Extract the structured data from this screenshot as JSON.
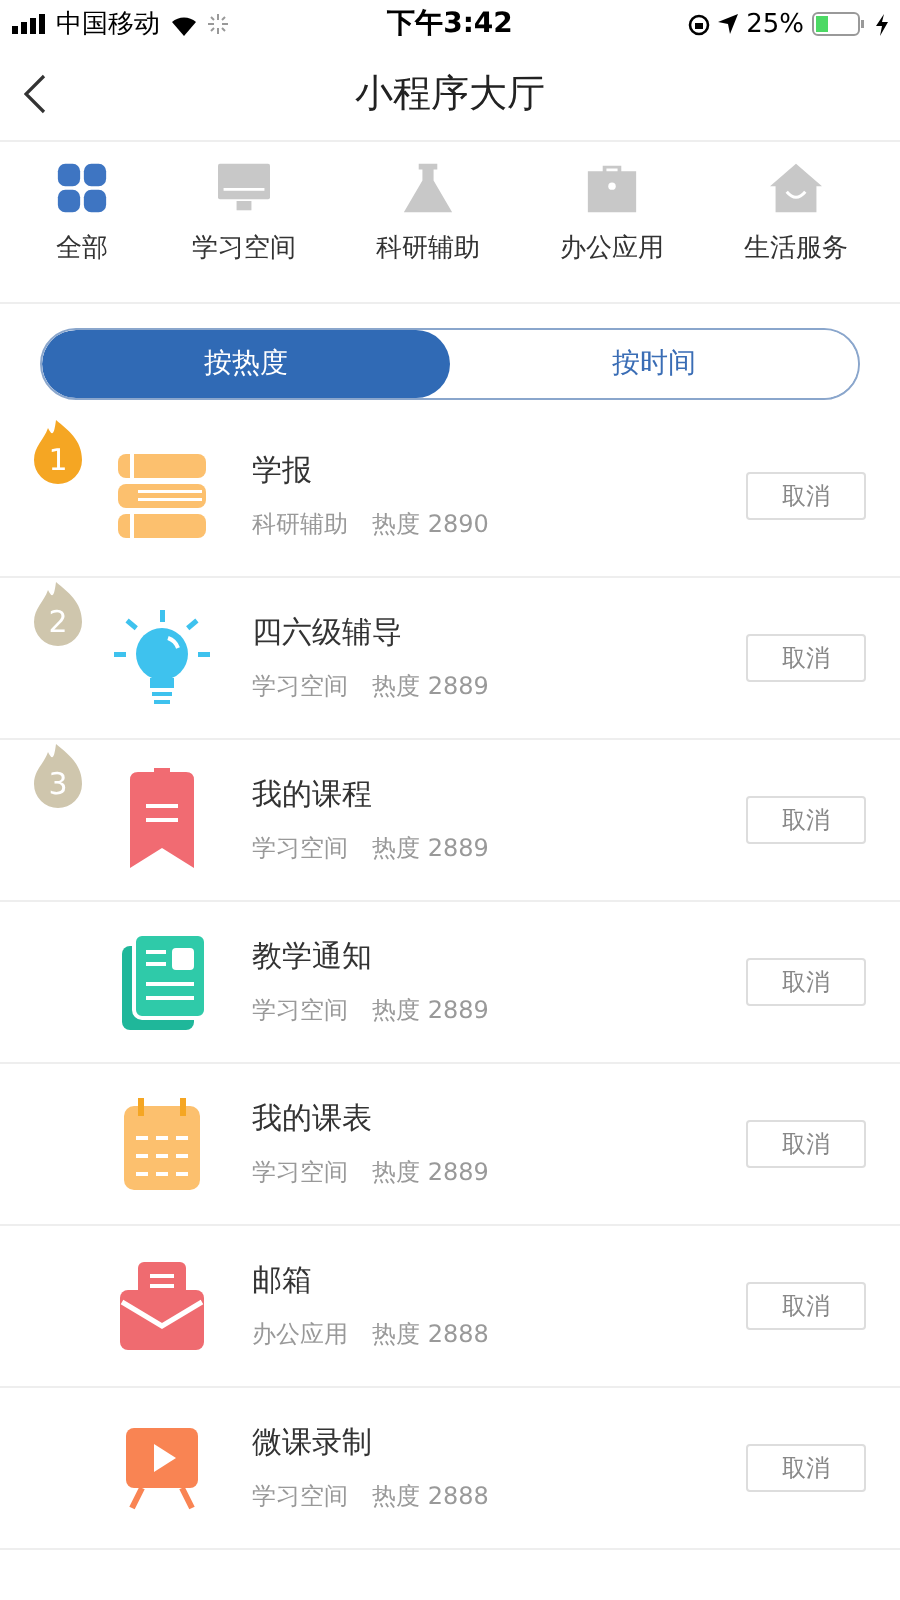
{
  "status_bar": {
    "carrier": "中国移动",
    "time": "下午3:42",
    "battery": "25%"
  },
  "nav": {
    "title": "小程序大厅"
  },
  "categories": [
    {
      "label": "全部",
      "kind": "all",
      "selected": true
    },
    {
      "label": "学习空间",
      "kind": "monitor",
      "selected": false
    },
    {
      "label": "科研辅助",
      "kind": "flask",
      "selected": false
    },
    {
      "label": "办公应用",
      "kind": "briefcase",
      "selected": false
    },
    {
      "label": "生活服务",
      "kind": "house",
      "selected": false
    }
  ],
  "sort_tabs": [
    {
      "label": "按热度",
      "selected": true
    },
    {
      "label": "按时间",
      "selected": false
    }
  ],
  "apps": [
    {
      "rank": "1",
      "color": "#f5a623",
      "kind": "books",
      "title": "学报",
      "category": "科研辅助",
      "heat": "热度 2890",
      "action": "取消"
    },
    {
      "rank": "2",
      "color": "#cfc6ad",
      "kind": "bulb",
      "title": "四六级辅导",
      "category": "学习空间",
      "heat": "热度 2889",
      "action": "取消"
    },
    {
      "rank": "3",
      "color": "#cfc6ad",
      "kind": "bookmark",
      "title": "我的课程",
      "category": "学习空间",
      "heat": "热度 2889",
      "action": "取消"
    },
    {
      "kind": "notice",
      "title": "教学通知",
      "category": "学习空间",
      "heat": "热度 2889",
      "action": "取消"
    },
    {
      "kind": "calendar",
      "title": "我的课表",
      "category": "学习空间",
      "heat": "热度 2889",
      "action": "取消"
    },
    {
      "kind": "mail",
      "title": "邮箱",
      "category": "办公应用",
      "heat": "热度 2888",
      "action": "取消"
    },
    {
      "kind": "video",
      "title": "微课录制",
      "category": "学习空间",
      "heat": "热度 2888",
      "action": "取消"
    }
  ]
}
